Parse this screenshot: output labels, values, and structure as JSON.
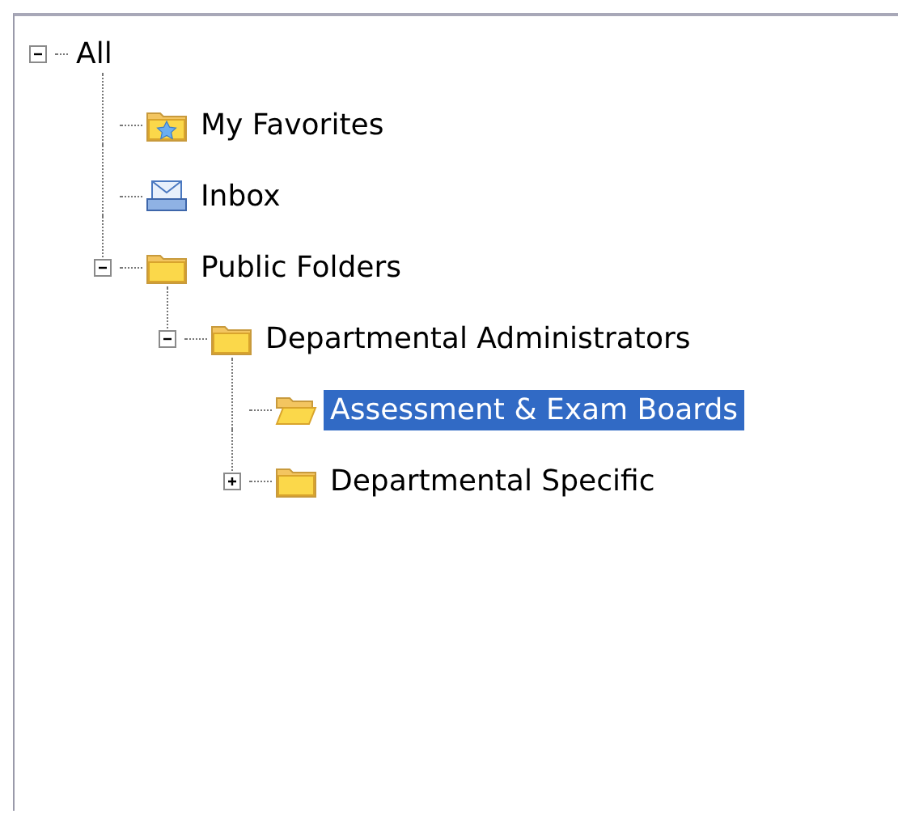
{
  "tree": {
    "nodes": [
      {
        "label": "All",
        "kind": "root",
        "expanded": true,
        "selected": false,
        "children": [
          {
            "label": "My Favorites",
            "kind": "favorites",
            "selected": false
          },
          {
            "label": "Inbox",
            "kind": "inbox",
            "selected": false
          },
          {
            "label": "Public Folders",
            "kind": "folder",
            "expanded": true,
            "selected": false,
            "children": [
              {
                "label": "Departmental Administrators",
                "kind": "folder",
                "expanded": true,
                "selected": false,
                "children": [
                  {
                    "label": "Assessment & Exam Boards",
                    "kind": "open-folder",
                    "selected": true
                  },
                  {
                    "label": "Departmental Specific",
                    "kind": "folder",
                    "expanded": false,
                    "selected": false
                  }
                ]
              }
            ]
          }
        ]
      }
    ]
  }
}
